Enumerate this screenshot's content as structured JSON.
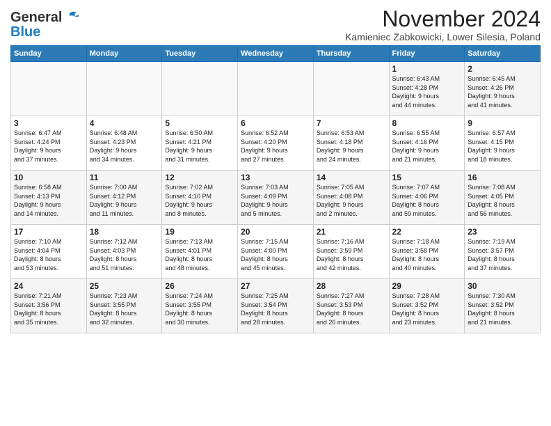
{
  "header": {
    "logo_general": "General",
    "logo_blue": "Blue",
    "month_title": "November 2024",
    "location": "Kamieniec Zabkowicki, Lower Silesia, Poland"
  },
  "days_of_week": [
    "Sunday",
    "Monday",
    "Tuesday",
    "Wednesday",
    "Thursday",
    "Friday",
    "Saturday"
  ],
  "weeks": [
    [
      {
        "day": "",
        "info": ""
      },
      {
        "day": "",
        "info": ""
      },
      {
        "day": "",
        "info": ""
      },
      {
        "day": "",
        "info": ""
      },
      {
        "day": "",
        "info": ""
      },
      {
        "day": "1",
        "info": "Sunrise: 6:43 AM\nSunset: 4:28 PM\nDaylight: 9 hours\nand 44 minutes."
      },
      {
        "day": "2",
        "info": "Sunrise: 6:45 AM\nSunset: 4:26 PM\nDaylight: 9 hours\nand 41 minutes."
      }
    ],
    [
      {
        "day": "3",
        "info": "Sunrise: 6:47 AM\nSunset: 4:24 PM\nDaylight: 9 hours\nand 37 minutes."
      },
      {
        "day": "4",
        "info": "Sunrise: 6:48 AM\nSunset: 4:23 PM\nDaylight: 9 hours\nand 34 minutes."
      },
      {
        "day": "5",
        "info": "Sunrise: 6:50 AM\nSunset: 4:21 PM\nDaylight: 9 hours\nand 31 minutes."
      },
      {
        "day": "6",
        "info": "Sunrise: 6:52 AM\nSunset: 4:20 PM\nDaylight: 9 hours\nand 27 minutes."
      },
      {
        "day": "7",
        "info": "Sunrise: 6:53 AM\nSunset: 4:18 PM\nDaylight: 9 hours\nand 24 minutes."
      },
      {
        "day": "8",
        "info": "Sunrise: 6:55 AM\nSunset: 4:16 PM\nDaylight: 9 hours\nand 21 minutes."
      },
      {
        "day": "9",
        "info": "Sunrise: 6:57 AM\nSunset: 4:15 PM\nDaylight: 9 hours\nand 18 minutes."
      }
    ],
    [
      {
        "day": "10",
        "info": "Sunrise: 6:58 AM\nSunset: 4:13 PM\nDaylight: 9 hours\nand 14 minutes."
      },
      {
        "day": "11",
        "info": "Sunrise: 7:00 AM\nSunset: 4:12 PM\nDaylight: 9 hours\nand 11 minutes."
      },
      {
        "day": "12",
        "info": "Sunrise: 7:02 AM\nSunset: 4:10 PM\nDaylight: 9 hours\nand 8 minutes."
      },
      {
        "day": "13",
        "info": "Sunrise: 7:03 AM\nSunset: 4:09 PM\nDaylight: 9 hours\nand 5 minutes."
      },
      {
        "day": "14",
        "info": "Sunrise: 7:05 AM\nSunset: 4:08 PM\nDaylight: 9 hours\nand 2 minutes."
      },
      {
        "day": "15",
        "info": "Sunrise: 7:07 AM\nSunset: 4:06 PM\nDaylight: 8 hours\nand 59 minutes."
      },
      {
        "day": "16",
        "info": "Sunrise: 7:08 AM\nSunset: 4:05 PM\nDaylight: 8 hours\nand 56 minutes."
      }
    ],
    [
      {
        "day": "17",
        "info": "Sunrise: 7:10 AM\nSunset: 4:04 PM\nDaylight: 8 hours\nand 53 minutes."
      },
      {
        "day": "18",
        "info": "Sunrise: 7:12 AM\nSunset: 4:03 PM\nDaylight: 8 hours\nand 51 minutes."
      },
      {
        "day": "19",
        "info": "Sunrise: 7:13 AM\nSunset: 4:01 PM\nDaylight: 8 hours\nand 48 minutes."
      },
      {
        "day": "20",
        "info": "Sunrise: 7:15 AM\nSunset: 4:00 PM\nDaylight: 8 hours\nand 45 minutes."
      },
      {
        "day": "21",
        "info": "Sunrise: 7:16 AM\nSunset: 3:59 PM\nDaylight: 8 hours\nand 42 minutes."
      },
      {
        "day": "22",
        "info": "Sunrise: 7:18 AM\nSunset: 3:58 PM\nDaylight: 8 hours\nand 40 minutes."
      },
      {
        "day": "23",
        "info": "Sunrise: 7:19 AM\nSunset: 3:57 PM\nDaylight: 8 hours\nand 37 minutes."
      }
    ],
    [
      {
        "day": "24",
        "info": "Sunrise: 7:21 AM\nSunset: 3:56 PM\nDaylight: 8 hours\nand 35 minutes."
      },
      {
        "day": "25",
        "info": "Sunrise: 7:23 AM\nSunset: 3:55 PM\nDaylight: 8 hours\nand 32 minutes."
      },
      {
        "day": "26",
        "info": "Sunrise: 7:24 AM\nSunset: 3:55 PM\nDaylight: 8 hours\nand 30 minutes."
      },
      {
        "day": "27",
        "info": "Sunrise: 7:25 AM\nSunset: 3:54 PM\nDaylight: 8 hours\nand 28 minutes."
      },
      {
        "day": "28",
        "info": "Sunrise: 7:27 AM\nSunset: 3:53 PM\nDaylight: 8 hours\nand 26 minutes."
      },
      {
        "day": "29",
        "info": "Sunrise: 7:28 AM\nSunset: 3:52 PM\nDaylight: 8 hours\nand 23 minutes."
      },
      {
        "day": "30",
        "info": "Sunrise: 7:30 AM\nSunset: 3:52 PM\nDaylight: 8 hours\nand 21 minutes."
      }
    ]
  ]
}
